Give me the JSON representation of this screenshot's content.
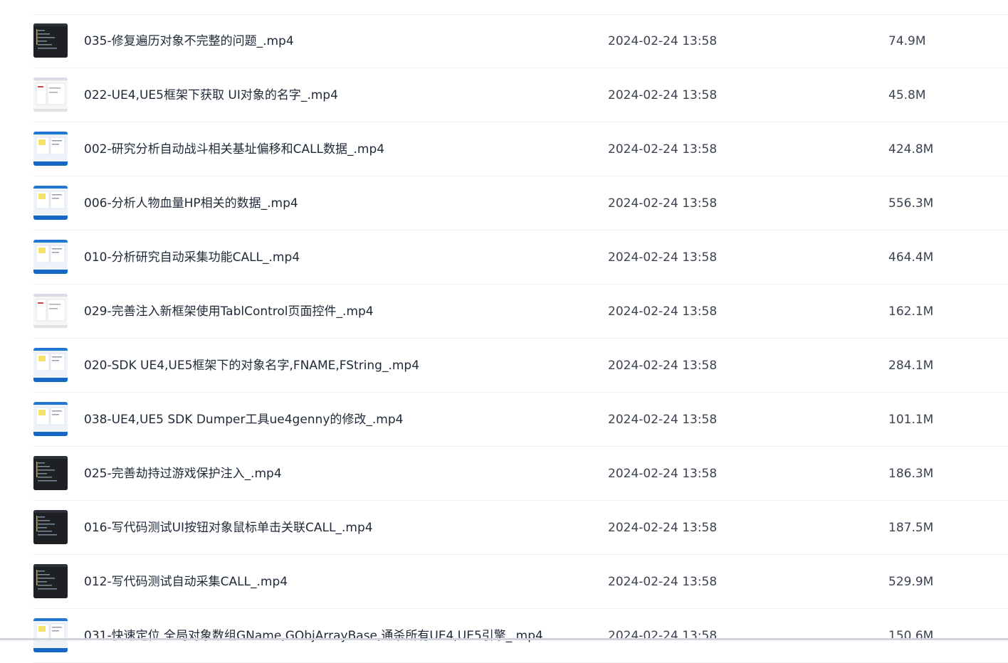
{
  "files": [
    {
      "name": "035-修复遍历对象不完整的问题_.mp4",
      "date": "2024-02-24 13:58",
      "size": "74.9M",
      "thumb": "dark"
    },
    {
      "name": "022-UE4,UE5框架下获取 UI对象的名字_.mp4",
      "date": "2024-02-24 13:58",
      "size": "45.8M",
      "thumb": "light"
    },
    {
      "name": "002-研究分析自动战斗相关基址偏移和CALL数据_.mp4",
      "date": "2024-02-24 13:58",
      "size": "424.8M",
      "thumb": "blue"
    },
    {
      "name": "006-分析人物血量HP相关的数据_.mp4",
      "date": "2024-02-24 13:58",
      "size": "556.3M",
      "thumb": "blue"
    },
    {
      "name": "010-分析研究自动采集功能CALL_.mp4",
      "date": "2024-02-24 13:58",
      "size": "464.4M",
      "thumb": "blue"
    },
    {
      "name": "029-完善注入新框架使用TablControl页面控件_.mp4",
      "date": "2024-02-24 13:58",
      "size": "162.1M",
      "thumb": "mixed"
    },
    {
      "name": "020-SDK UE4,UE5框架下的对象名字,FNAME,FString_.mp4",
      "date": "2024-02-24 13:58",
      "size": "284.1M",
      "thumb": "blue"
    },
    {
      "name": "038-UE4,UE5 SDK Dumper工具ue4genny的修改_.mp4",
      "date": "2024-02-24 13:58",
      "size": "101.1M",
      "thumb": "blue"
    },
    {
      "name": "025-完善劫持过游戏保护注入_.mp4",
      "date": "2024-02-24 13:58",
      "size": "186.3M",
      "thumb": "dark"
    },
    {
      "name": "016-写代码测试UI按钮对象鼠标单击关联CALL_.mp4",
      "date": "2024-02-24 13:58",
      "size": "187.5M",
      "thumb": "dark"
    },
    {
      "name": "012-写代码测试自动采集CALL_.mp4",
      "date": "2024-02-24 13:58",
      "size": "529.9M",
      "thumb": "dark"
    },
    {
      "name": "031-快速定位 全局对象数组GName,GObjArrayBase,通杀所有UE4,UE5引擎_.mp4",
      "date": "2024-02-24 13:58",
      "size": "150.6M",
      "thumb": "blue"
    }
  ]
}
